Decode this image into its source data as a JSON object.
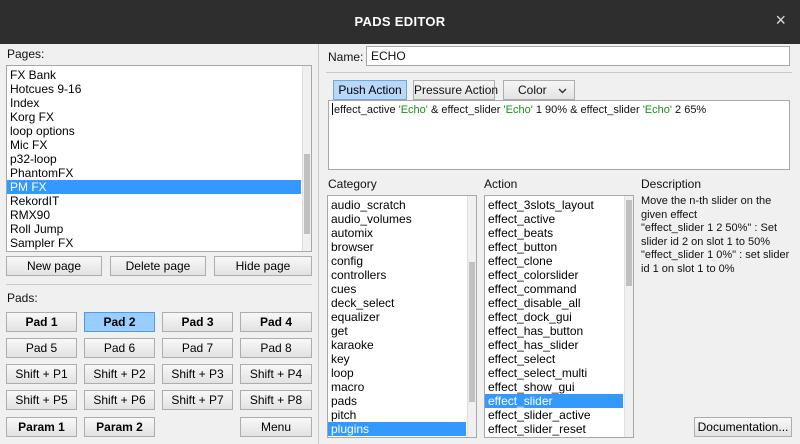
{
  "window": {
    "title": "PADS EDITOR",
    "close_icon": "×"
  },
  "pages": {
    "label": "Pages:",
    "items": [
      "FX Bank",
      "Hotcues 9-16",
      "Index",
      "Korg FX",
      "loop options",
      "Mic FX",
      "p32-loop",
      "PhantomFX",
      "PM FX",
      "RekordIT",
      "RMX90",
      "Roll Jump",
      "Sampler FX"
    ],
    "selected_index": 8
  },
  "page_buttons": {
    "new": "New page",
    "delete": "Delete page",
    "hide": "Hide page"
  },
  "pads": {
    "label": "Pads:",
    "row1": [
      "Pad 1",
      "Pad 2",
      "Pad 3",
      "Pad 4"
    ],
    "row2": [
      "Pad 5",
      "Pad 6",
      "Pad 7",
      "Pad 8"
    ],
    "row3": [
      "Shift + P1",
      "Shift + P2",
      "Shift + P3",
      "Shift + P4"
    ],
    "row4": [
      "Shift + P5",
      "Shift + P6",
      "Shift + P7",
      "Shift + P8"
    ],
    "row5": [
      "Param 1",
      "Param 2",
      "Menu"
    ],
    "selected": "Pad 2"
  },
  "name": {
    "label": "Name:",
    "value": "ECHO"
  },
  "tabs": {
    "push": "Push Action",
    "pressure": "Pressure Action",
    "color": "Color",
    "color_arrow": "chevron-down"
  },
  "script": {
    "p1": "effect_active ",
    "s1": "'Echo'",
    "p2": " & effect_slider ",
    "s2": "'Echo'",
    "p3": " 1 90% & effect_slider ",
    "s3": "'Echo'",
    "p4": " 2 65%"
  },
  "category": {
    "label": "Category",
    "items": [
      "audio_scratch",
      "audio_volumes",
      "automix",
      "browser",
      "config",
      "controllers",
      "cues",
      "deck_select",
      "equalizer",
      "get",
      "karaoke",
      "key",
      "loop",
      "macro",
      "pads",
      "pitch",
      "plugins"
    ],
    "selected_index": 16
  },
  "action": {
    "label": "Action",
    "items": [
      "effect_3slots_layout",
      "effect_active",
      "effect_beats",
      "effect_button",
      "effect_clone",
      "effect_colorslider",
      "effect_command",
      "effect_disable_all",
      "effect_dock_gui",
      "effect_has_button",
      "effect_has_slider",
      "effect_select",
      "effect_select_multi",
      "effect_show_gui",
      "effect_slider",
      "effect_slider_active",
      "effect_slider_reset"
    ],
    "selected_index": 14
  },
  "description": {
    "label": "Description",
    "lines": [
      "Move the n-th slider on the",
      "given effect",
      "\"effect_slider 1 2 50%\" : Set",
      "slider id 2 on slot 1 to 50%",
      "\"effect_slider 1 0%\" : set slider",
      "id 1 on slot 1 to 0%"
    ]
  },
  "documentation_button": "Documentation..."
}
